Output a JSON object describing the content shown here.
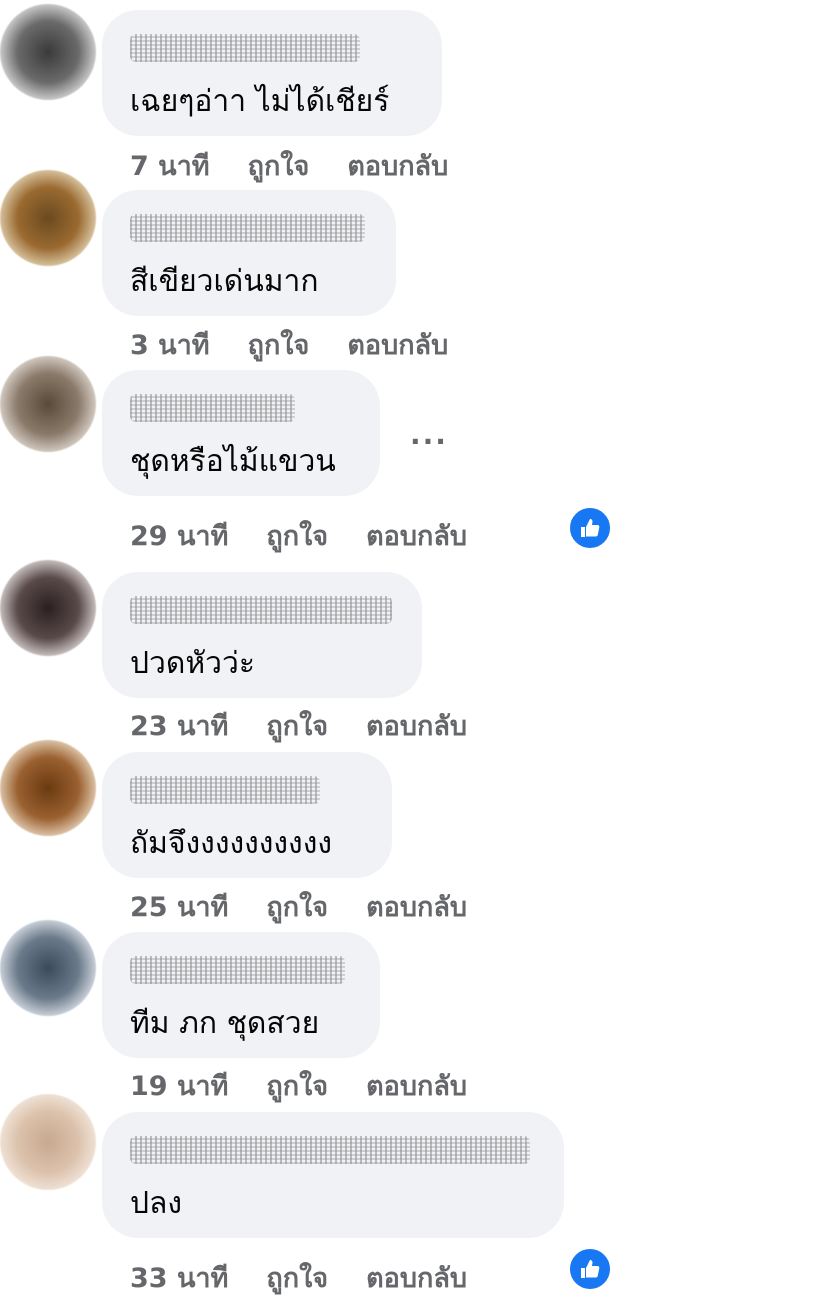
{
  "comments": [
    {
      "author": "xxxxxxxxx xxxxxx",
      "text": "เฉยๆอ่าา ไม่ได้เชียร์",
      "time": "7 นาที",
      "like": "ถูกใจ",
      "reply": "ตอบกลับ"
    },
    {
      "author": "xxxxxxxx xxxx xxxxxx",
      "text": "สีเขียวเด่นมาก",
      "time": "3 นาที",
      "like": "ถูกใจ",
      "reply": "ตอบกลับ"
    },
    {
      "author": "xxxxx xxxxx",
      "text": "ชุดหรือไม้แขวน",
      "time": "29 นาที",
      "like": "ถูกใจ",
      "reply": "ตอบกลับ",
      "more": "..."
    },
    {
      "author": "xxxxxx xxxxxxxxxxxx",
      "text": "ปวดหัวว่ะ",
      "time": "23 นาที",
      "like": "ถูกใจ",
      "reply": "ตอบกลับ"
    },
    {
      "author": "xxxxxx xxxxxxx",
      "text": "ถัมจึงงงงงงงงงง",
      "time": "25 นาที",
      "like": "ถูกใจ",
      "reply": "ตอบกลับ"
    },
    {
      "author": "xxxxxxxxx xxxxxxx",
      "text": "ทีม ภก ชุดสวย",
      "time": "19 นาที",
      "like": "ถูกใจ",
      "reply": "ตอบกลับ"
    },
    {
      "author": "xxxxx xxxxxxxx xxxxxxxxxai",
      "text": "ปลง",
      "time": "33 นาที",
      "like": "ถูกใจ",
      "reply": "ตอบกลับ"
    }
  ],
  "colors": {
    "bubble": "#f0f2f5",
    "meta": "#65676b",
    "like_badge": "#1877f2"
  },
  "icons": {
    "like": "thumbs-up-icon",
    "more": "more-options-icon"
  }
}
